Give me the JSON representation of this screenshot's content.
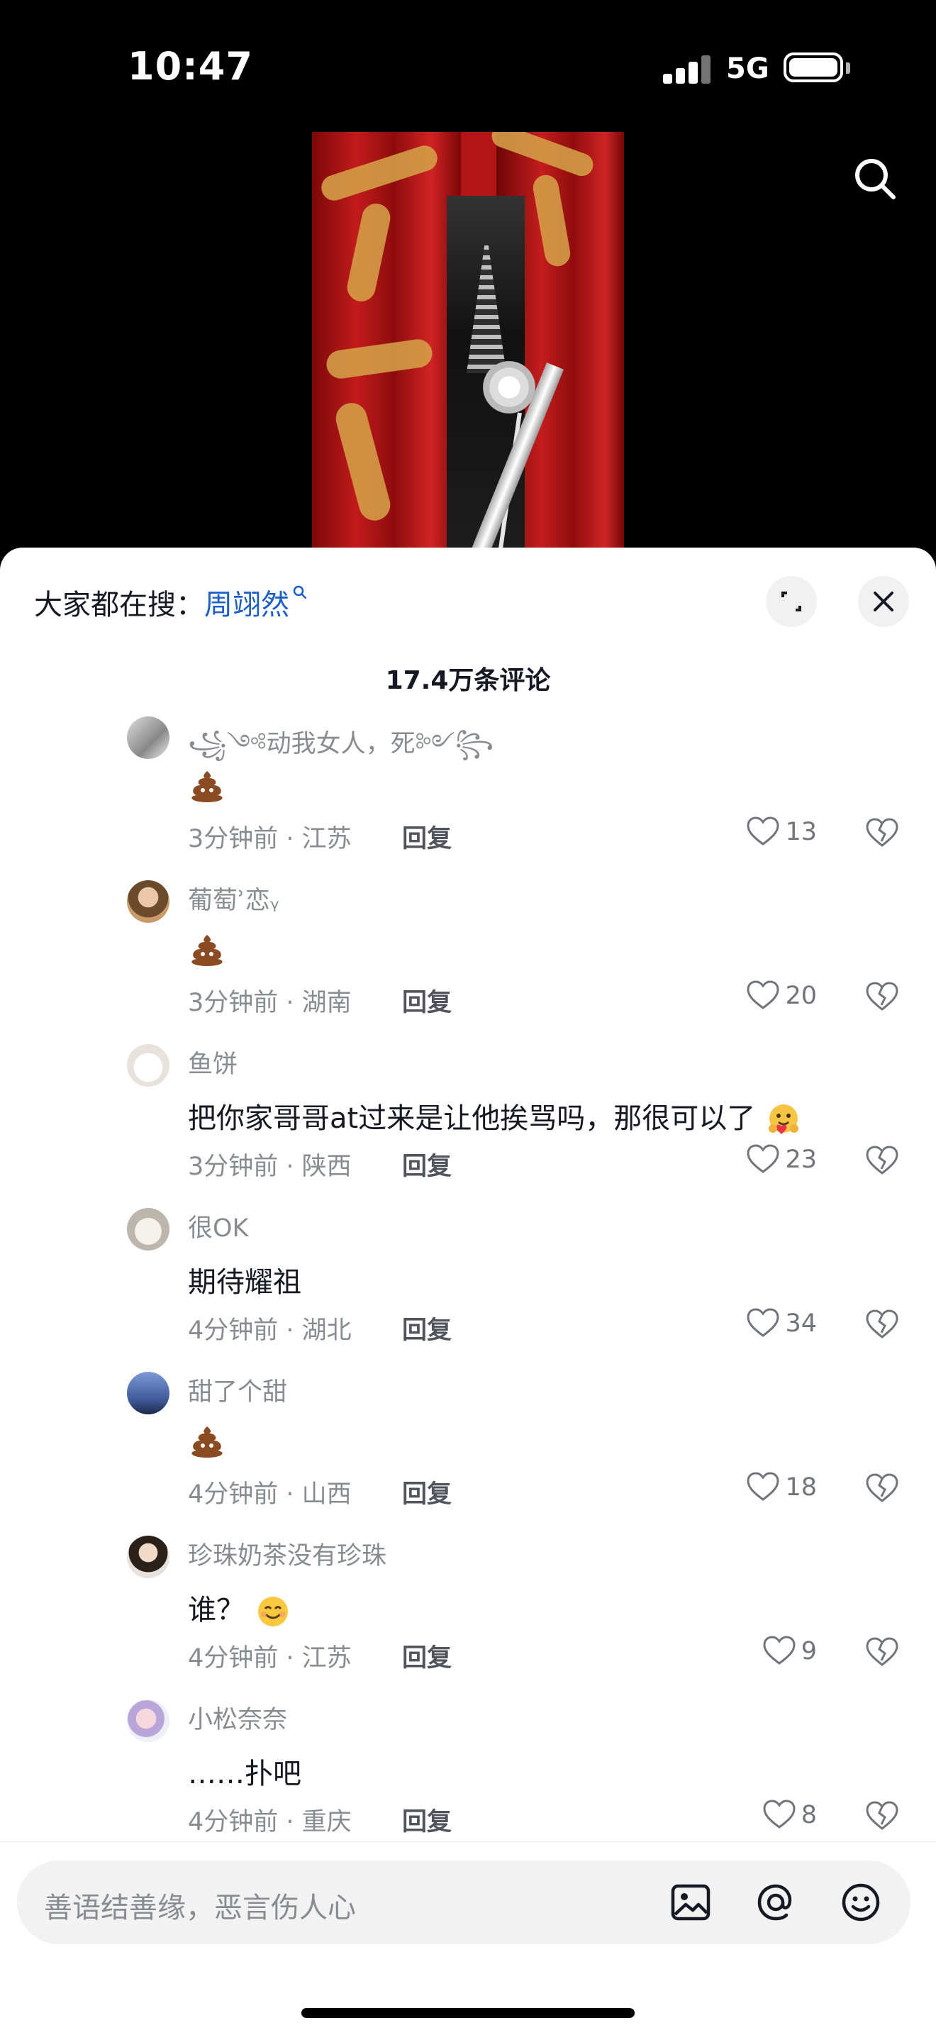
{
  "status_bar": {
    "time": "10:47",
    "network": "5G"
  },
  "search_bar": {
    "prefix": "大家都在搜：",
    "term": "周翊然"
  },
  "comments_header": {
    "count_label": "17.4万条评论"
  },
  "comments": [
    {
      "user": "꧁༺动我女人，死༻꧂",
      "text": "",
      "emoji": "poop",
      "meta": "3分钟前 · 江苏",
      "reply": "回复",
      "likes": "13"
    },
    {
      "user": "葡萄ʾ恋ᵧ",
      "text": "",
      "emoji": "poop",
      "meta": "3分钟前 · 湖南",
      "reply": "回复",
      "likes": "20"
    },
    {
      "user": "鱼饼",
      "text": "把你家哥哥at过来是让他挨骂吗，那很可以了",
      "emoji": "hug-face",
      "meta": "3分钟前 · 陕西",
      "reply": "回复",
      "likes": "23"
    },
    {
      "user": "很OK",
      "text": "期待耀祖",
      "emoji": "",
      "meta": "4分钟前 · 湖北",
      "reply": "回复",
      "likes": "34"
    },
    {
      "user": "甜了个甜",
      "text": "",
      "emoji": "poop",
      "meta": "4分钟前 · 山西",
      "reply": "回复",
      "likes": "18"
    },
    {
      "user": "珍珠奶茶没有珍珠",
      "text": "谁？",
      "emoji": "smile-face",
      "meta": "4分钟前 · 江苏",
      "reply": "回复",
      "likes": "9"
    },
    {
      "user": "小松奈奈",
      "text": "……扑吧",
      "emoji": "",
      "meta": "4分钟前 · 重庆",
      "reply": "回复",
      "likes": "8"
    }
  ],
  "input": {
    "placeholder": "善语结善缘，恶言伤人心"
  },
  "colors": {
    "accent_link": "#1d5ec7",
    "sheet_bg": "#ffffff",
    "muted_text": "#8a8b91"
  }
}
